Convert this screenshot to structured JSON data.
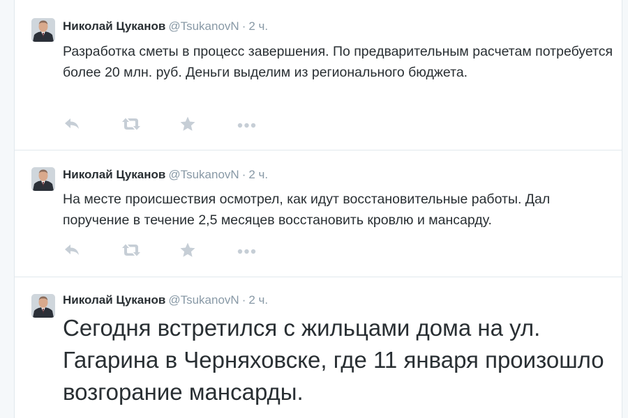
{
  "colors": {
    "name": "#292f33",
    "meta": "#8899a6",
    "icon": "#c6ced6",
    "border": "#e1e8ed"
  },
  "tweets": [
    {
      "fullname": "Николай Цуканов",
      "username": "@TsukanovN",
      "dot": "·",
      "time": "2 ч.",
      "text": "Разработка сметы в процесс завершения. По предварительным расчетам потребуется более 20 млн. руб. Деньги выделим из регионального бюджета.",
      "actions": [
        "reply-icon",
        "retweet-icon",
        "favorite-star-icon",
        "more-dots-icon"
      ]
    },
    {
      "fullname": "Николай Цуканов",
      "username": "@TsukanovN",
      "dot": "·",
      "time": "2 ч.",
      "text": "На месте происшествия осмотрел, как идут восстановительные работы. Дал поручение в течение 2,5 месяцев восстановить кровлю и мансарду.",
      "actions": [
        "reply-icon",
        "retweet-icon",
        "favorite-star-icon",
        "more-dots-icon"
      ]
    },
    {
      "fullname": "Николай Цуканов",
      "username": "@TsukanovN",
      "dot": "·",
      "time": "2 ч.",
      "text": "Сегодня встретился с жильцами дома на ул. Гагарина в Черняховске, где 11 января произошло возгорание мансарды."
    }
  ]
}
